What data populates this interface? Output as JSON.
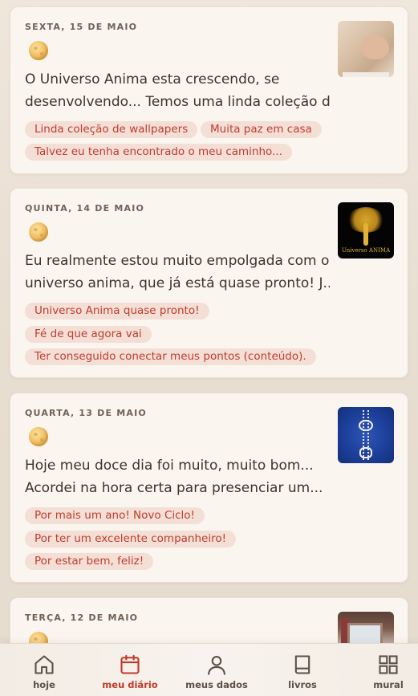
{
  "entries": [
    {
      "date": "SEXTA, 15 DE MAIO",
      "mood_icon": "moon-icon",
      "text_line1": "O Universo Anima esta crescendo, se",
      "text_line2": "desenvolvendo... Temos uma linda coleção d...",
      "tags": [
        "Linda coleção de wallpapers",
        "Muita paz em casa",
        "Talvez eu tenha encontrado o meu caminho..."
      ],
      "thumbnail": "hand-painting-photo"
    },
    {
      "date": "QUINTA, 14 DE MAIO",
      "mood_icon": "moon-icon",
      "text_line1": "Eu realmente estou muito empolgada com o",
      "text_line2": "universo anima, que já está quase pronto! J...",
      "tags": [
        "Universo Anima quase pronto!",
        "Fé de que agora vai",
        "Ter conseguido conectar meus pontos (conteúdo)."
      ],
      "thumbnail": "golden-tree-image",
      "thumbnail_text": "Universo ANIMA"
    },
    {
      "date": "QUARTA, 13 DE MAIO",
      "mood_icon": "moon-icon",
      "text_line1": "Hoje meu doce dia foi muito, muito bom...",
      "text_line2": "Acordei na hora certa para presenciar um...",
      "tags": [
        "Por mais um ano! Novo Ciclo!",
        "Por ter um excelente companheiro!",
        "Por estar bem, feliz!"
      ],
      "thumbnail": "owl-necklace-photo"
    },
    {
      "date": "TERÇA, 12 DE MAIO",
      "mood_icon": "moon-icon",
      "thumbnail": "window-photo"
    }
  ],
  "nav": {
    "items": [
      {
        "label": "hoje",
        "icon": "home-icon",
        "active": false
      },
      {
        "label": "meu diário",
        "icon": "calendar-icon",
        "active": true
      },
      {
        "label": "meus dados",
        "icon": "user-icon",
        "active": false
      },
      {
        "label": "livros",
        "icon": "book-icon",
        "active": false
      },
      {
        "label": "mural",
        "icon": "grid-icon",
        "active": false
      }
    ],
    "active_color": "#c0392b",
    "inactive_color": "#5c5148"
  },
  "colors": {
    "tag_background": "#f3dfd6",
    "tag_text": "#bf3d2e",
    "card_background": "#fbf5ef"
  }
}
